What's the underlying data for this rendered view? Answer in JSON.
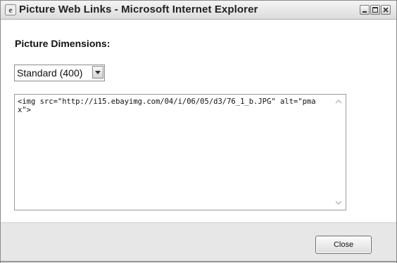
{
  "window": {
    "title": "Picture Web Links - Microsoft Internet Explorer",
    "icons": [
      "ie-icon",
      "minimize-icon",
      "maximize-icon",
      "close-icon"
    ]
  },
  "content": {
    "heading": "Picture Dimensions:",
    "size_select": {
      "value": "Standard (400)",
      "icon": "chevron-down-icon"
    },
    "code_text": "<img src=\"http://i15.ebayimg.com/04/i/06/05/d3/76_1_b.JPG\" alt=\"pmax\">"
  },
  "footer": {
    "close_label": "Close"
  }
}
